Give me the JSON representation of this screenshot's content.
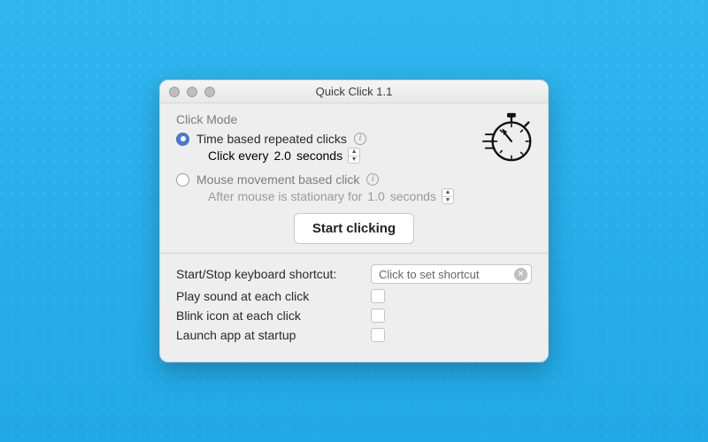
{
  "window": {
    "title": "Quick Click 1.1"
  },
  "section": {
    "label": "Click Mode"
  },
  "modes": {
    "time": {
      "label": "Time based repeated clicks",
      "sub_prefix": "Click every",
      "value": "2.0",
      "unit": "seconds",
      "selected": true
    },
    "movement": {
      "label": "Mouse movement based click",
      "sub_prefix": "After mouse is stationary for",
      "value": "1.0",
      "unit": "seconds",
      "selected": false
    }
  },
  "start_button": "Start clicking",
  "shortcut": {
    "label": "Start/Stop keyboard shortcut:",
    "placeholder": "Click to set shortcut"
  },
  "options": {
    "play_sound": "Play sound at each click",
    "blink_icon": "Blink icon at each click",
    "launch_startup": "Launch app at startup"
  }
}
